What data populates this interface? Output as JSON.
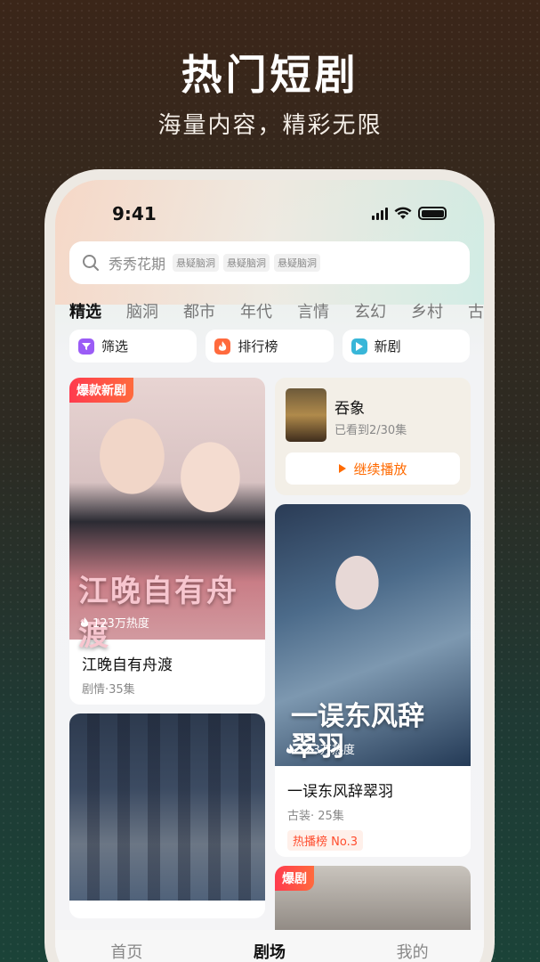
{
  "hero": {
    "title": "热门短剧",
    "subtitle": "海量内容，精彩无限"
  },
  "status_bar": {
    "time": "9:41"
  },
  "search": {
    "placeholder": "秀秀花期",
    "hot_tags": [
      "悬疑脑洞",
      "悬疑脑洞",
      "悬疑脑洞"
    ]
  },
  "category_tabs": [
    "精选",
    "脑洞",
    "都市",
    "年代",
    "言情",
    "玄幻",
    "乡村",
    "古"
  ],
  "active_tab": "精选",
  "quick_actions": [
    {
      "label": "筛选",
      "icon": "filter-icon",
      "color": "#9b5cf6"
    },
    {
      "label": "排行榜",
      "icon": "flame-icon",
      "color": "#ff6a3d"
    },
    {
      "label": "新剧",
      "icon": "play-icon",
      "color": "#38b6d8"
    }
  ],
  "cards": {
    "featured": {
      "badge": "爆款新剧",
      "poster_title": "江晚自有舟渡",
      "heat": "123万热度",
      "title": "江晚自有舟渡",
      "meta": "剧情·35集"
    },
    "continue_watching": {
      "title": "吞象",
      "progress": "已看到2/30集",
      "button": "继续播放"
    },
    "drama2": {
      "poster_title": "一误东风辞翠羽",
      "heat": "123万热度",
      "title": "一误东风辞翠羽",
      "meta": "古装· 25集",
      "rank": "热播榜 No.3"
    },
    "drama3": {},
    "drama4": {
      "badge": "爆剧"
    }
  },
  "bottom_nav": [
    "首页",
    "剧场",
    "我的"
  ],
  "active_nav": "剧场",
  "colors": {
    "accent": "#ff6a00",
    "badge_red": "#ff3b4e",
    "rank_text": "#ff4d2e"
  }
}
